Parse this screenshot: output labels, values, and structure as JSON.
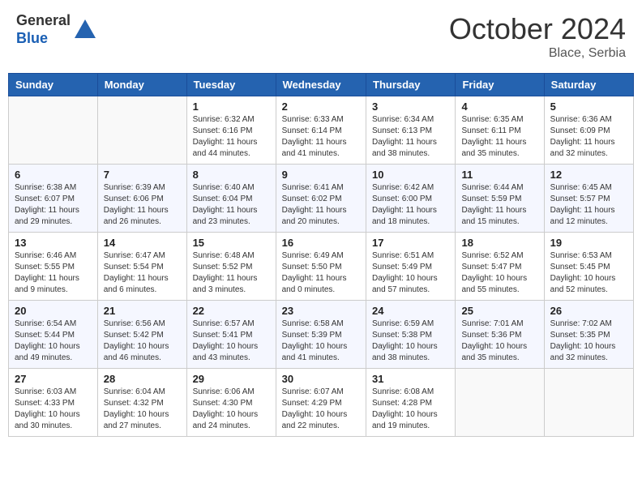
{
  "header": {
    "logo_general": "General",
    "logo_blue": "Blue",
    "month_title": "October 2024",
    "location": "Blace, Serbia"
  },
  "weekdays": [
    "Sunday",
    "Monday",
    "Tuesday",
    "Wednesday",
    "Thursday",
    "Friday",
    "Saturday"
  ],
  "weeks": [
    [
      {
        "day": "",
        "info": ""
      },
      {
        "day": "",
        "info": ""
      },
      {
        "day": "1",
        "info": "Sunrise: 6:32 AM\nSunset: 6:16 PM\nDaylight: 11 hours and 44 minutes."
      },
      {
        "day": "2",
        "info": "Sunrise: 6:33 AM\nSunset: 6:14 PM\nDaylight: 11 hours and 41 minutes."
      },
      {
        "day": "3",
        "info": "Sunrise: 6:34 AM\nSunset: 6:13 PM\nDaylight: 11 hours and 38 minutes."
      },
      {
        "day": "4",
        "info": "Sunrise: 6:35 AM\nSunset: 6:11 PM\nDaylight: 11 hours and 35 minutes."
      },
      {
        "day": "5",
        "info": "Sunrise: 6:36 AM\nSunset: 6:09 PM\nDaylight: 11 hours and 32 minutes."
      }
    ],
    [
      {
        "day": "6",
        "info": "Sunrise: 6:38 AM\nSunset: 6:07 PM\nDaylight: 11 hours and 29 minutes."
      },
      {
        "day": "7",
        "info": "Sunrise: 6:39 AM\nSunset: 6:06 PM\nDaylight: 11 hours and 26 minutes."
      },
      {
        "day": "8",
        "info": "Sunrise: 6:40 AM\nSunset: 6:04 PM\nDaylight: 11 hours and 23 minutes."
      },
      {
        "day": "9",
        "info": "Sunrise: 6:41 AM\nSunset: 6:02 PM\nDaylight: 11 hours and 20 minutes."
      },
      {
        "day": "10",
        "info": "Sunrise: 6:42 AM\nSunset: 6:00 PM\nDaylight: 11 hours and 18 minutes."
      },
      {
        "day": "11",
        "info": "Sunrise: 6:44 AM\nSunset: 5:59 PM\nDaylight: 11 hours and 15 minutes."
      },
      {
        "day": "12",
        "info": "Sunrise: 6:45 AM\nSunset: 5:57 PM\nDaylight: 11 hours and 12 minutes."
      }
    ],
    [
      {
        "day": "13",
        "info": "Sunrise: 6:46 AM\nSunset: 5:55 PM\nDaylight: 11 hours and 9 minutes."
      },
      {
        "day": "14",
        "info": "Sunrise: 6:47 AM\nSunset: 5:54 PM\nDaylight: 11 hours and 6 minutes."
      },
      {
        "day": "15",
        "info": "Sunrise: 6:48 AM\nSunset: 5:52 PM\nDaylight: 11 hours and 3 minutes."
      },
      {
        "day": "16",
        "info": "Sunrise: 6:49 AM\nSunset: 5:50 PM\nDaylight: 11 hours and 0 minutes."
      },
      {
        "day": "17",
        "info": "Sunrise: 6:51 AM\nSunset: 5:49 PM\nDaylight: 10 hours and 57 minutes."
      },
      {
        "day": "18",
        "info": "Sunrise: 6:52 AM\nSunset: 5:47 PM\nDaylight: 10 hours and 55 minutes."
      },
      {
        "day": "19",
        "info": "Sunrise: 6:53 AM\nSunset: 5:45 PM\nDaylight: 10 hours and 52 minutes."
      }
    ],
    [
      {
        "day": "20",
        "info": "Sunrise: 6:54 AM\nSunset: 5:44 PM\nDaylight: 10 hours and 49 minutes."
      },
      {
        "day": "21",
        "info": "Sunrise: 6:56 AM\nSunset: 5:42 PM\nDaylight: 10 hours and 46 minutes."
      },
      {
        "day": "22",
        "info": "Sunrise: 6:57 AM\nSunset: 5:41 PM\nDaylight: 10 hours and 43 minutes."
      },
      {
        "day": "23",
        "info": "Sunrise: 6:58 AM\nSunset: 5:39 PM\nDaylight: 10 hours and 41 minutes."
      },
      {
        "day": "24",
        "info": "Sunrise: 6:59 AM\nSunset: 5:38 PM\nDaylight: 10 hours and 38 minutes."
      },
      {
        "day": "25",
        "info": "Sunrise: 7:01 AM\nSunset: 5:36 PM\nDaylight: 10 hours and 35 minutes."
      },
      {
        "day": "26",
        "info": "Sunrise: 7:02 AM\nSunset: 5:35 PM\nDaylight: 10 hours and 32 minutes."
      }
    ],
    [
      {
        "day": "27",
        "info": "Sunrise: 6:03 AM\nSunset: 4:33 PM\nDaylight: 10 hours and 30 minutes."
      },
      {
        "day": "28",
        "info": "Sunrise: 6:04 AM\nSunset: 4:32 PM\nDaylight: 10 hours and 27 minutes."
      },
      {
        "day": "29",
        "info": "Sunrise: 6:06 AM\nSunset: 4:30 PM\nDaylight: 10 hours and 24 minutes."
      },
      {
        "day": "30",
        "info": "Sunrise: 6:07 AM\nSunset: 4:29 PM\nDaylight: 10 hours and 22 minutes."
      },
      {
        "day": "31",
        "info": "Sunrise: 6:08 AM\nSunset: 4:28 PM\nDaylight: 10 hours and 19 minutes."
      },
      {
        "day": "",
        "info": ""
      },
      {
        "day": "",
        "info": ""
      }
    ]
  ]
}
